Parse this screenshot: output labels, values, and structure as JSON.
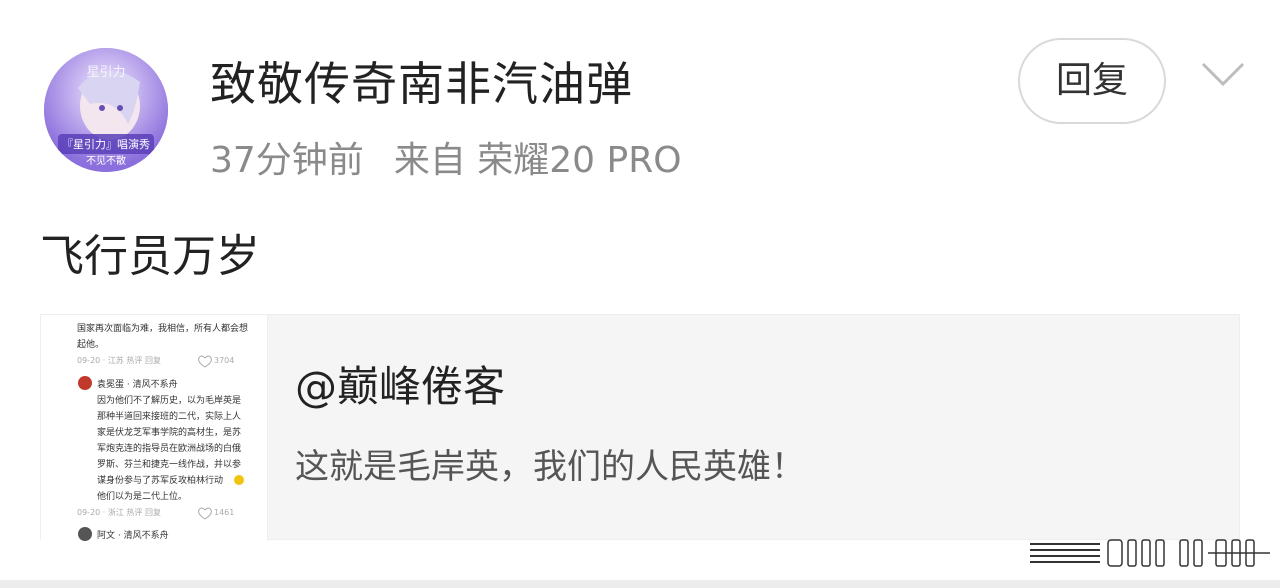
{
  "post": {
    "username": "致敬传奇南非汽油弹",
    "time": "37分钟前",
    "source": "来自 荣耀20 PRO",
    "content": "飞行员万岁",
    "reply_label": "回复",
    "avatar_text_top": "星引力",
    "avatar_text_mid": "『星引力』唱演秀",
    "avatar_text_bottom": "不见不散"
  },
  "quote": {
    "username": "@巅峰倦客",
    "text": "这就是毛岸英，我们的人民英雄！",
    "thumbnail": {
      "line1": "国家再次面临为难，我相信，所有人都会想",
      "line2": "起他。",
      "meta1": "09-20 · 江苏 热评 回复",
      "likes1": "3704",
      "commenter1": "袁冕蛋 · 清风不系舟",
      "c1_l1": "因为他们不了解历史，以为毛岸英是",
      "c1_l2": "那种半道回来接班的二代，实际上人",
      "c1_l3": "家是伏龙芝军事学院的高材生，是苏",
      "c1_l4": "军炮克连的指导员在欧洲战场的白俄",
      "c1_l5": "罗斯、芬兰和捷克一线作战，并以参",
      "c1_l6": "谋身份参与了苏军反攻柏林行动",
      "c1_l7": "他们以为是二代上位。",
      "meta2": "09-20 · 浙江 热评 回复",
      "likes2": "1461",
      "commenter2": "阿文 · 清风不系舟"
    }
  },
  "colors": {
    "text_primary": "#222222",
    "text_meta": "#8a8a8a",
    "quote_bg": "#f5f5f5",
    "button_border": "#d9d9d9"
  },
  "icons": {
    "expand": "chevron-down-icon",
    "watermark": "barcode-watermark"
  }
}
